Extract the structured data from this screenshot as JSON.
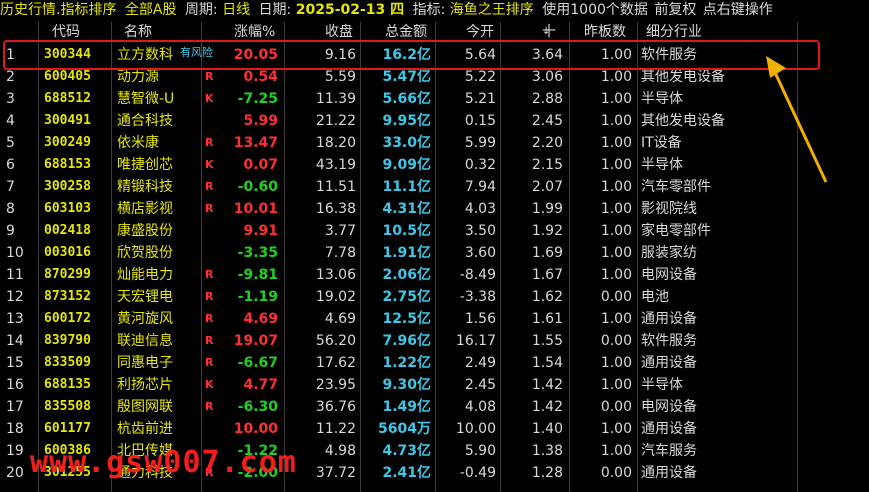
{
  "topbar": {
    "mode": "历史行情.指标排序",
    "market": "全部A股",
    "period_label": "周期:",
    "period": "日线",
    "date_label": "日期:",
    "date": "2025-02-13 四",
    "indicator_label": "指标:",
    "indicator": "海鱼之王排序",
    "data_info": "使用1000个数据",
    "adjust": "前复权",
    "hint": "点右键操作"
  },
  "columns": {
    "code": "代码",
    "name": "名称",
    "pct": "涨幅%",
    "close": "收盘",
    "amount": "总金额",
    "open": "今开",
    "ten": "十",
    "prev_board": "昨板数",
    "industry": "细分行业"
  },
  "risk_tag": "有风险",
  "watermark": "www.gsw007.com",
  "colors": {
    "highlight_border": "#e01818",
    "arrow": "#f0b000",
    "up": "#ff3030",
    "down": "#22d022",
    "cyan": "#3cc8e8",
    "yellow": "#e6e600"
  },
  "rows": [
    {
      "idx": "1",
      "code": "300344",
      "name": "立方数科",
      "tag": "",
      "pct": "20.05",
      "dir": "up",
      "close": "9.16",
      "amount": "16.2亿",
      "open": "5.64",
      "ten": "3.64",
      "prev": "1.00",
      "industry": "软件服务"
    },
    {
      "idx": "2",
      "code": "600405",
      "name": "动力源",
      "tag": "R",
      "pct": "0.54",
      "dir": "up",
      "close": "5.59",
      "amount": "5.47亿",
      "open": "5.22",
      "ten": "3.06",
      "prev": "1.00",
      "industry": "其他发电设备"
    },
    {
      "idx": "3",
      "code": "688512",
      "name": "慧智微-U",
      "tag": "K",
      "pct": "-7.25",
      "dir": "down",
      "close": "11.39",
      "amount": "5.66亿",
      "open": "5.21",
      "ten": "2.88",
      "prev": "1.00",
      "industry": "半导体"
    },
    {
      "idx": "4",
      "code": "300491",
      "name": "通合科技",
      "tag": "",
      "pct": "5.99",
      "dir": "up",
      "close": "21.22",
      "amount": "9.95亿",
      "open": "0.15",
      "ten": "2.45",
      "prev": "1.00",
      "industry": "其他发电设备"
    },
    {
      "idx": "5",
      "code": "300249",
      "name": "依米康",
      "tag": "R",
      "pct": "13.47",
      "dir": "up",
      "close": "18.20",
      "amount": "33.0亿",
      "open": "5.99",
      "ten": "2.20",
      "prev": "1.00",
      "industry": "IT设备"
    },
    {
      "idx": "6",
      "code": "688153",
      "name": "唯捷创芯",
      "tag": "K",
      "pct": "0.07",
      "dir": "up",
      "close": "43.19",
      "amount": "9.09亿",
      "open": "0.32",
      "ten": "2.15",
      "prev": "1.00",
      "industry": "半导体"
    },
    {
      "idx": "7",
      "code": "300258",
      "name": "精锻科技",
      "tag": "R",
      "pct": "-0.60",
      "dir": "down",
      "close": "11.51",
      "amount": "11.1亿",
      "open": "7.94",
      "ten": "2.07",
      "prev": "1.00",
      "industry": "汽车零部件"
    },
    {
      "idx": "8",
      "code": "603103",
      "name": "横店影视",
      "tag": "R",
      "pct": "10.01",
      "dir": "up",
      "close": "16.38",
      "amount": "4.31亿",
      "open": "4.03",
      "ten": "1.99",
      "prev": "1.00",
      "industry": "影视院线"
    },
    {
      "idx": "9",
      "code": "002418",
      "name": "康盛股份",
      "tag": "",
      "pct": "9.91",
      "dir": "up",
      "close": "3.77",
      "amount": "10.5亿",
      "open": "3.50",
      "ten": "1.92",
      "prev": "1.00",
      "industry": "家电零部件"
    },
    {
      "idx": "10",
      "code": "003016",
      "name": "欣贺股份",
      "tag": "",
      "pct": "-3.35",
      "dir": "down",
      "close": "7.78",
      "amount": "1.91亿",
      "open": "3.60",
      "ten": "1.69",
      "prev": "1.00",
      "industry": "服装家纺"
    },
    {
      "idx": "11",
      "code": "870299",
      "name": "灿能电力",
      "tag": "R",
      "pct": "-9.81",
      "dir": "down",
      "close": "13.06",
      "amount": "2.06亿",
      "open": "-8.49",
      "ten": "1.67",
      "prev": "1.00",
      "industry": "电网设备"
    },
    {
      "idx": "12",
      "code": "873152",
      "name": "天宏锂电",
      "tag": "R",
      "pct": "-1.19",
      "dir": "down",
      "close": "19.02",
      "amount": "2.75亿",
      "open": "-3.38",
      "ten": "1.62",
      "prev": "0.00",
      "industry": "电池"
    },
    {
      "idx": "13",
      "code": "600172",
      "name": "黄河旋风",
      "tag": "R",
      "pct": "4.69",
      "dir": "up",
      "close": "4.69",
      "amount": "12.5亿",
      "open": "1.56",
      "ten": "1.61",
      "prev": "1.00",
      "industry": "通用设备"
    },
    {
      "idx": "14",
      "code": "839790",
      "name": "联迪信息",
      "tag": "R",
      "pct": "19.07",
      "dir": "up",
      "close": "56.20",
      "amount": "7.96亿",
      "open": "16.17",
      "ten": "1.55",
      "prev": "0.00",
      "industry": "软件服务"
    },
    {
      "idx": "15",
      "code": "833509",
      "name": "同惠电子",
      "tag": "R",
      "pct": "-6.67",
      "dir": "down",
      "close": "17.62",
      "amount": "1.22亿",
      "open": "2.49",
      "ten": "1.54",
      "prev": "1.00",
      "industry": "通用设备"
    },
    {
      "idx": "16",
      "code": "688135",
      "name": "利扬芯片",
      "tag": "K",
      "pct": "4.77",
      "dir": "up",
      "close": "23.95",
      "amount": "9.30亿",
      "open": "2.45",
      "ten": "1.42",
      "prev": "1.00",
      "industry": "半导体"
    },
    {
      "idx": "17",
      "code": "835508",
      "name": "殷图网联",
      "tag": "R",
      "pct": "-6.30",
      "dir": "down",
      "close": "36.76",
      "amount": "1.49亿",
      "open": "4.08",
      "ten": "1.42",
      "prev": "0.00",
      "industry": "电网设备"
    },
    {
      "idx": "18",
      "code": "601177",
      "name": "杭齿前进",
      "tag": "",
      "pct": "10.00",
      "dir": "up",
      "close": "11.22",
      "amount": "5604万",
      "open": "10.00",
      "ten": "1.40",
      "prev": "1.00",
      "industry": "通用设备"
    },
    {
      "idx": "19",
      "code": "600386",
      "name": "北巴传媒",
      "tag": "",
      "pct": "-1.22",
      "dir": "down",
      "close": "4.98",
      "amount": "4.73亿",
      "open": "5.90",
      "ten": "1.38",
      "prev": "1.00",
      "industry": "汽车服务"
    },
    {
      "idx": "20",
      "code": "301255",
      "name": "通力科技",
      "tag": "R",
      "pct": "-2.00",
      "dir": "down",
      "close": "37.72",
      "amount": "2.41亿",
      "open": "-0.49",
      "ten": "1.28",
      "prev": "0.00",
      "industry": "通用设备"
    }
  ]
}
